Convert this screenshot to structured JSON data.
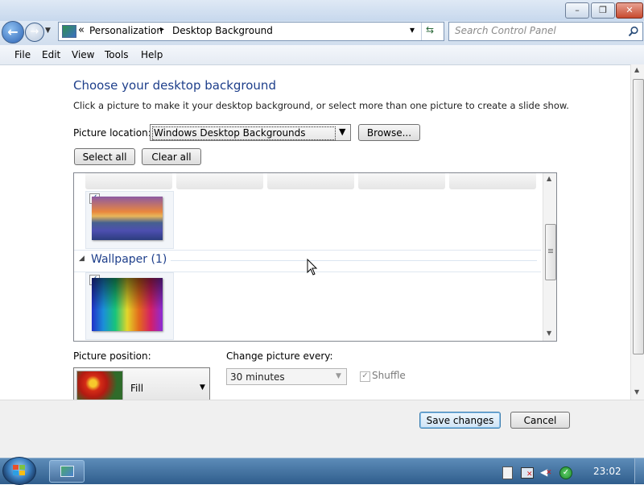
{
  "window": {
    "minimize_glyph": "–",
    "maximize_glyph": "❐",
    "close_glyph": "✕"
  },
  "address": {
    "chevron": "«",
    "crumbs": [
      "Personalization",
      "Desktop Background"
    ],
    "crumb_sep": "▸",
    "dropdown_glyph": "▾",
    "refresh_glyph": "⇆",
    "search_placeholder": "Search Control Panel",
    "search_icon": "search-icon"
  },
  "menubar": {
    "items": [
      "File",
      "Edit",
      "View",
      "Tools",
      "Help"
    ]
  },
  "content": {
    "title": "Choose your desktop background",
    "subtitle": "Click a picture to make it your desktop background, or select more than one picture to create a slide show.",
    "picture_location_label": "Picture location:",
    "picture_location_value": "Windows Desktop Backgrounds",
    "browse_label": "Browse...",
    "select_all_label": "Select all",
    "clear_all_label": "Clear all",
    "group_label": "Wallpaper (1)",
    "check_glyph": "✓",
    "picture_position_label": "Picture position:",
    "picture_position_value": "Fill",
    "change_every_label": "Change picture every:",
    "change_every_value": "30 minutes",
    "shuffle_label": "Shuffle"
  },
  "footer": {
    "save_label": "Save changes",
    "cancel_label": "Cancel"
  },
  "taskbar": {
    "time": "23:02"
  },
  "colors": {
    "title_blue": "#1e3f8b",
    "accent_blue": "#3c7fb1"
  }
}
